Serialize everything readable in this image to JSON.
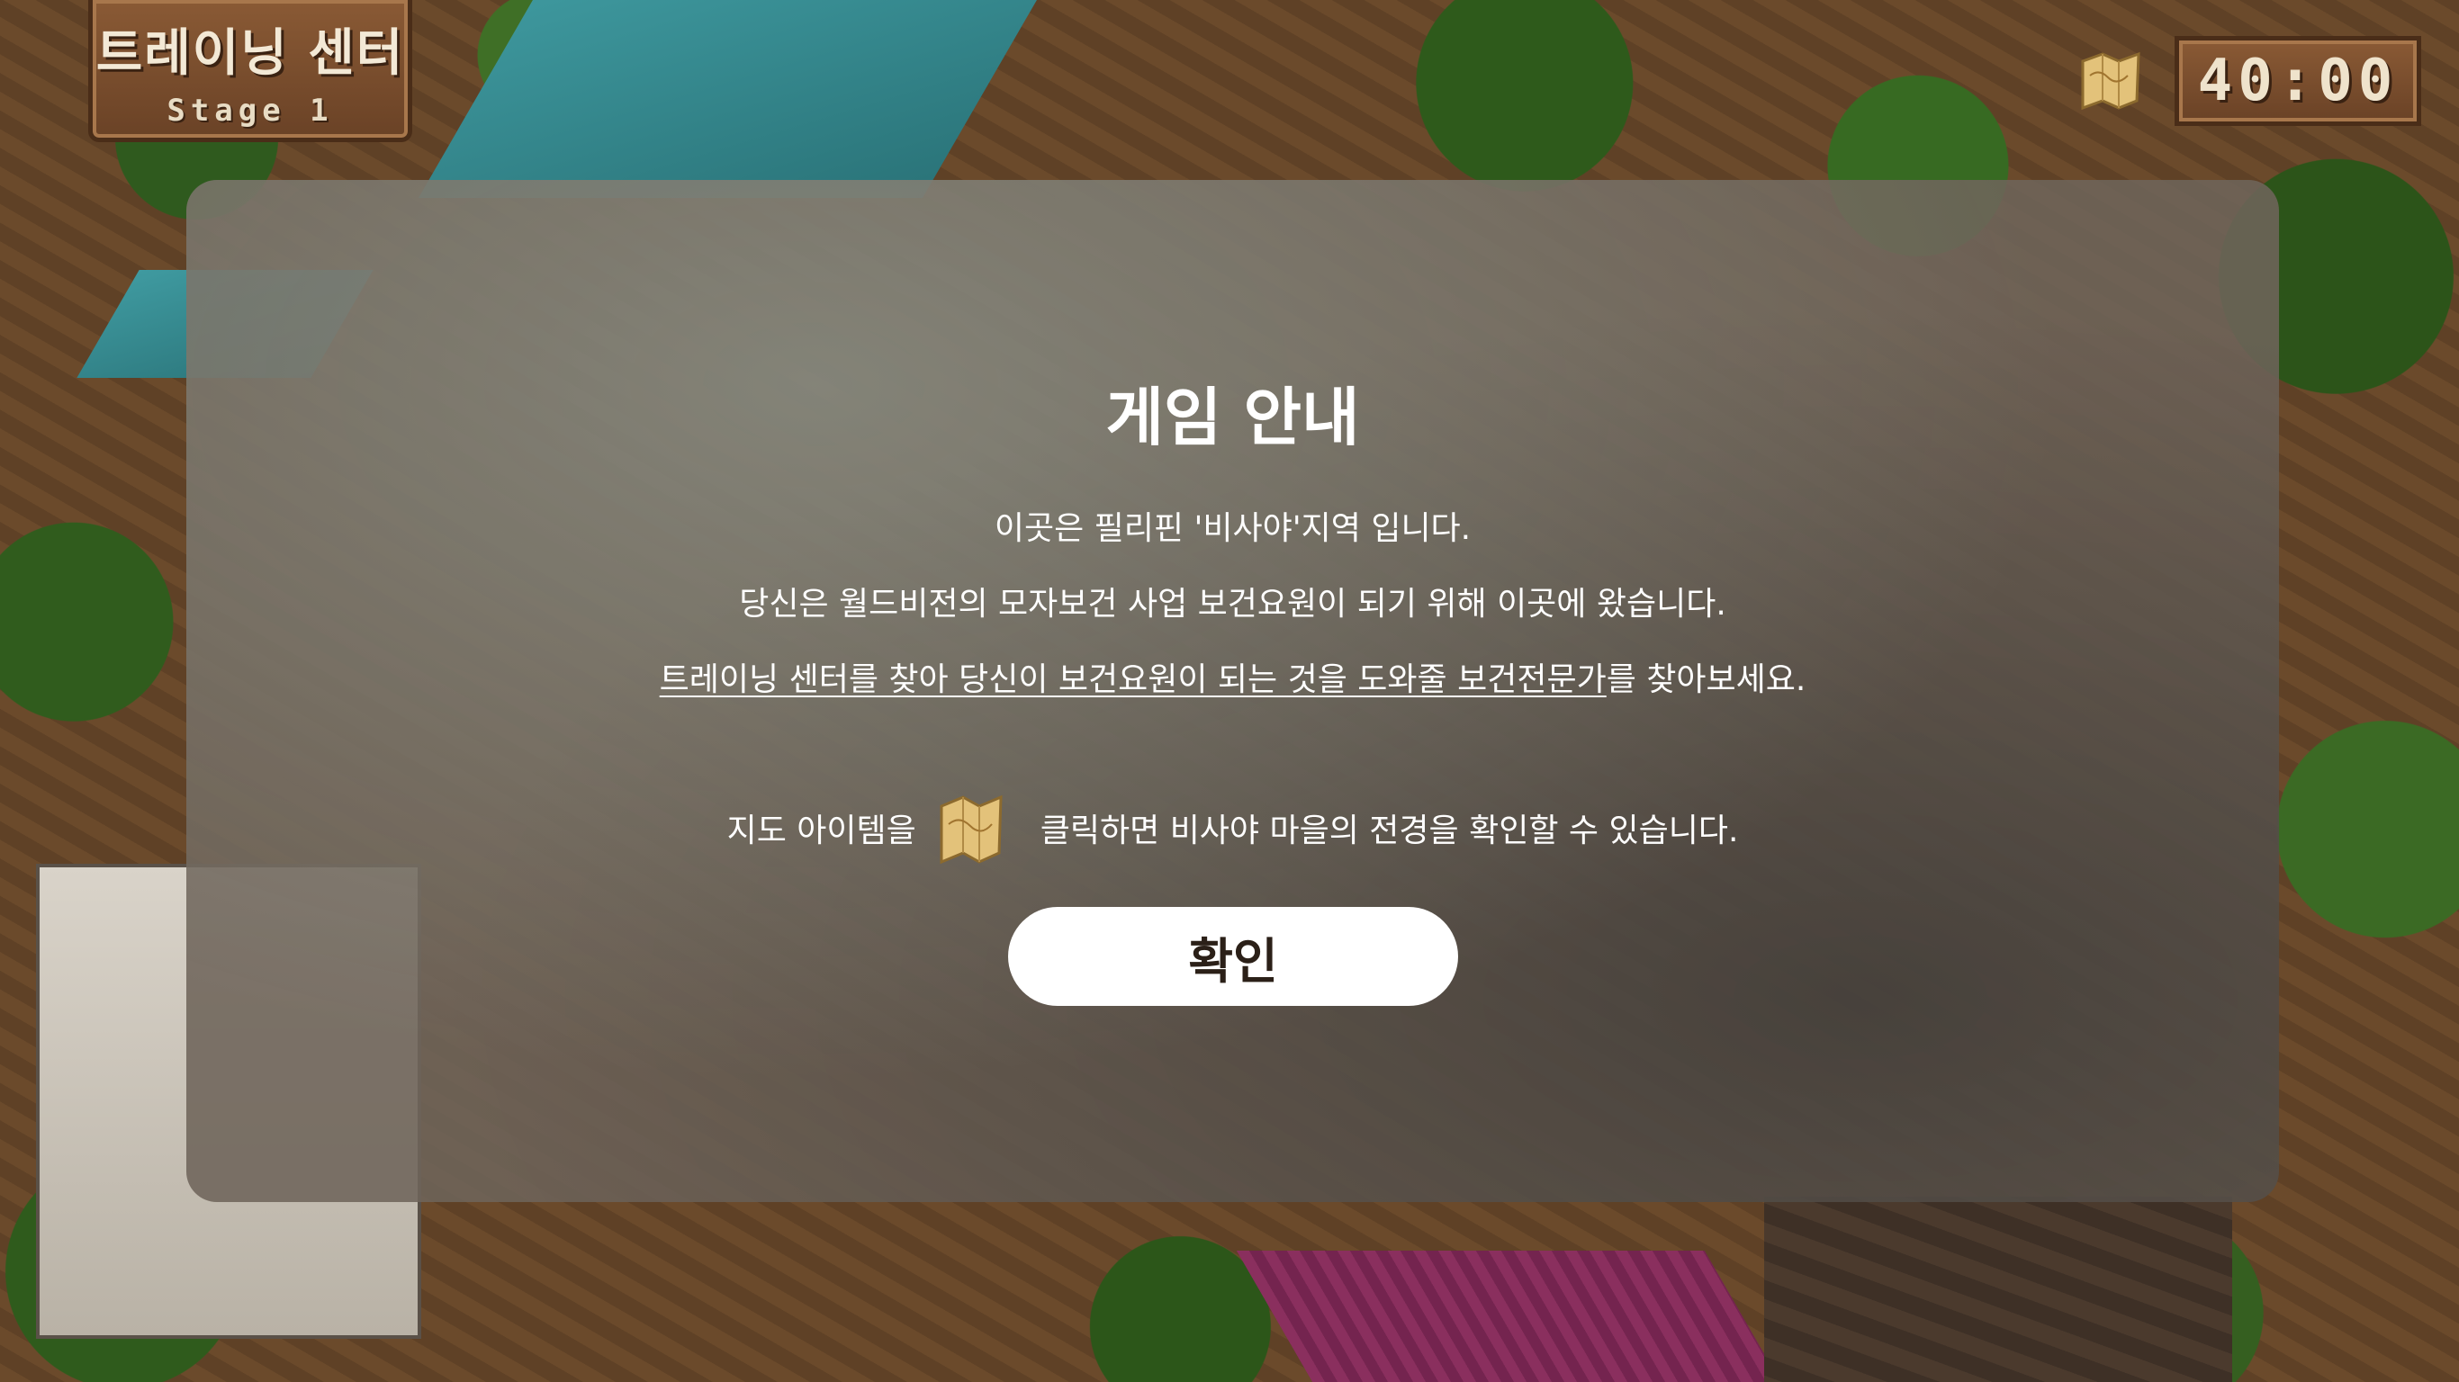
{
  "hud": {
    "stage_title": "트레이닝 센터",
    "stage_subtitle": "Stage 1",
    "timer": "40:00",
    "map_icon": "map-scroll-icon"
  },
  "modal": {
    "title": "게임 안내",
    "line1": "이곳은 필리핀 '비사야'지역 입니다.",
    "line2": "당신은 월드비전의 모자보건 사업 보건요원이 되기 위해 이곳에 왔습니다.",
    "line3_underlined": "트레이닝 센터를 찾아 당신이 보건요원이 되는 것을 도와줄 보건전문가",
    "line3_rest": "를 찾아보세요.",
    "line4_before": "지도 아이템을",
    "line4_icon": "map-scroll-icon",
    "line4_after": "클릭하면 비사야 마을의 전경을 확인할 수 있습니다.",
    "confirm_label": "확인"
  },
  "colors": {
    "modal_overlay": "#6e645a",
    "button_bg": "#ffffff",
    "button_text": "#2b2018",
    "hud_wood": "#7a4e2e"
  }
}
